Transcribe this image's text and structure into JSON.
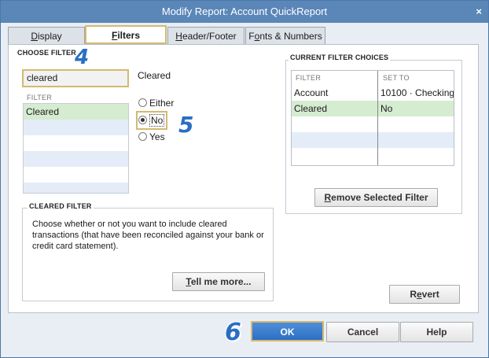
{
  "window": {
    "title": "Modify Report: Account QuickReport",
    "close_glyph": "×"
  },
  "tabs": [
    {
      "label": "Display",
      "ul": "D",
      "rest": "isplay"
    },
    {
      "label": "Filters",
      "ul": "F",
      "rest": "ilters",
      "active": true
    },
    {
      "label": "Header/Footer",
      "ul": "H",
      "rest": "eader/Footer"
    },
    {
      "label": "Fonts & Numbers",
      "pre": "F",
      "ul": "o",
      "rest": "nts & Numbers"
    }
  ],
  "choose_filter": {
    "section_label": "CHOOSE FILTER",
    "input_value": "cleared",
    "list_header": "FILTER",
    "items": [
      "Cleared",
      "",
      "",
      "",
      "",
      ""
    ],
    "selected_index": 0,
    "field_label": "Cleared",
    "radio_options": [
      "Either",
      "No",
      "Yes"
    ],
    "radio_selected": "No"
  },
  "cleared_filter": {
    "section_label": "CLEARED FILTER",
    "description": "Choose whether or not you want to include cleared transactions (that have been reconciled against your bank or credit card statement).",
    "tell_me_more": {
      "ul": "T",
      "rest": "ell me more..."
    }
  },
  "current_filters": {
    "section_label": "CURRENT FILTER CHOICES",
    "columns": [
      "FILTER",
      "SET TO"
    ],
    "rows": [
      {
        "filter": "Account",
        "set_to": "10100 · Checking"
      },
      {
        "filter": "Cleared",
        "set_to": "No"
      }
    ],
    "remove_button": {
      "ul": "R",
      "rest": "emove Selected Filter"
    }
  },
  "revert_button": {
    "pre": "R",
    "ul": "e",
    "rest": "vert"
  },
  "buttons": {
    "ok": "OK",
    "cancel": "Cancel",
    "help": "Help"
  },
  "callouts": [
    "4",
    "5",
    "6"
  ],
  "colors": {
    "title_bar": "#5a86b8",
    "highlight_border": "#d4b970",
    "callout": "#2a6ec4",
    "selected_row": "#d5ecd0",
    "ok_button": "#2c6fc4"
  }
}
